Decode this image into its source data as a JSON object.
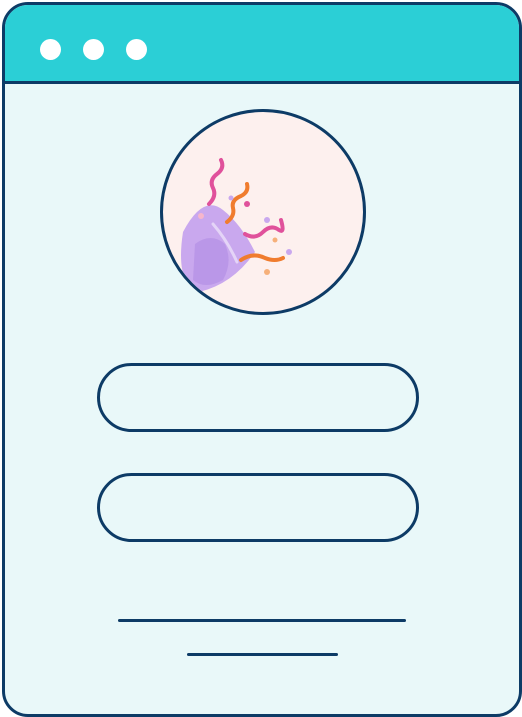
{
  "window": {
    "titlebar_color": "#2bcfd6",
    "content_color": "#e9f8f9",
    "border_color": "#0d3b66",
    "controls": [
      "close-dot",
      "minimize-dot",
      "maximize-dot"
    ]
  },
  "avatar": {
    "icon": "party-popper-icon",
    "background": "#fdf0ee",
    "colors": {
      "popper": "#c9a8ee",
      "popper_shade": "#a983e0",
      "confetti_pink": "#e0519b",
      "confetti_orange": "#f07c2e"
    }
  },
  "form": {
    "field_1": {
      "value": "",
      "placeholder": ""
    },
    "field_2": {
      "value": "",
      "placeholder": ""
    }
  },
  "text_lines": [
    "primary-text-line",
    "secondary-text-line"
  ]
}
